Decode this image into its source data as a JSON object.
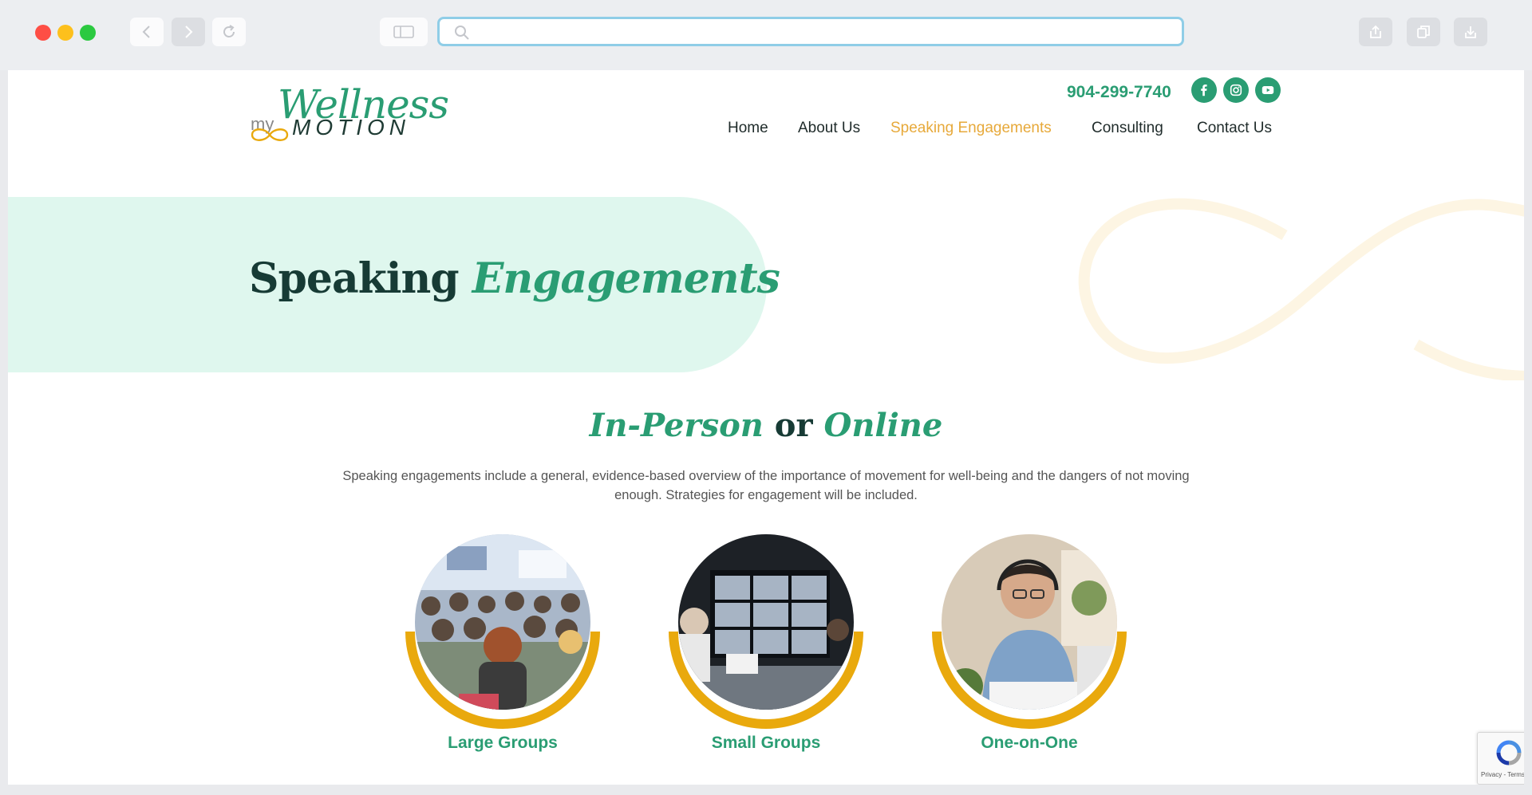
{
  "browser": {
    "url": "",
    "icons": [
      "chevron-left-icon",
      "chevron-right-icon",
      "reload-icon",
      "sidebar-icon",
      "search-icon",
      "share-icon",
      "tabs-icon",
      "download-icon"
    ]
  },
  "header": {
    "logo": {
      "my": "my",
      "wellness": "Wellness",
      "motion": "MOTION"
    },
    "phone": "904-299-7740",
    "social": [
      "facebook-icon",
      "instagram-icon",
      "youtube-icon"
    ],
    "nav": [
      {
        "label": "Home",
        "active": false
      },
      {
        "label": "About Us",
        "active": false
      },
      {
        "label": "Speaking Engagements",
        "active": true
      },
      {
        "label": "Consulting",
        "active": false
      },
      {
        "label": "Contact Us",
        "active": false
      }
    ]
  },
  "hero": {
    "title_plain": "Speaking",
    "title_em": "Engagements"
  },
  "intro": {
    "title_em1": "In-Person",
    "title_mid": "or",
    "title_em2": "Online",
    "description": "Speaking engagements include a general, evidence-based overview of the importance of movement for well-being and the dangers of not moving enough. Strategies for engagement will be included."
  },
  "cards": [
    {
      "label": "Large Groups"
    },
    {
      "label": "Small Groups"
    },
    {
      "label": "One-on-One"
    }
  ],
  "recaptcha": {
    "text": "Privacy - Terms"
  },
  "colors": {
    "green": "#2a9d73",
    "gold": "#e9a90d",
    "dark": "#173b35",
    "mint": "#dff7ee",
    "active_nav": "#e7a93a"
  }
}
